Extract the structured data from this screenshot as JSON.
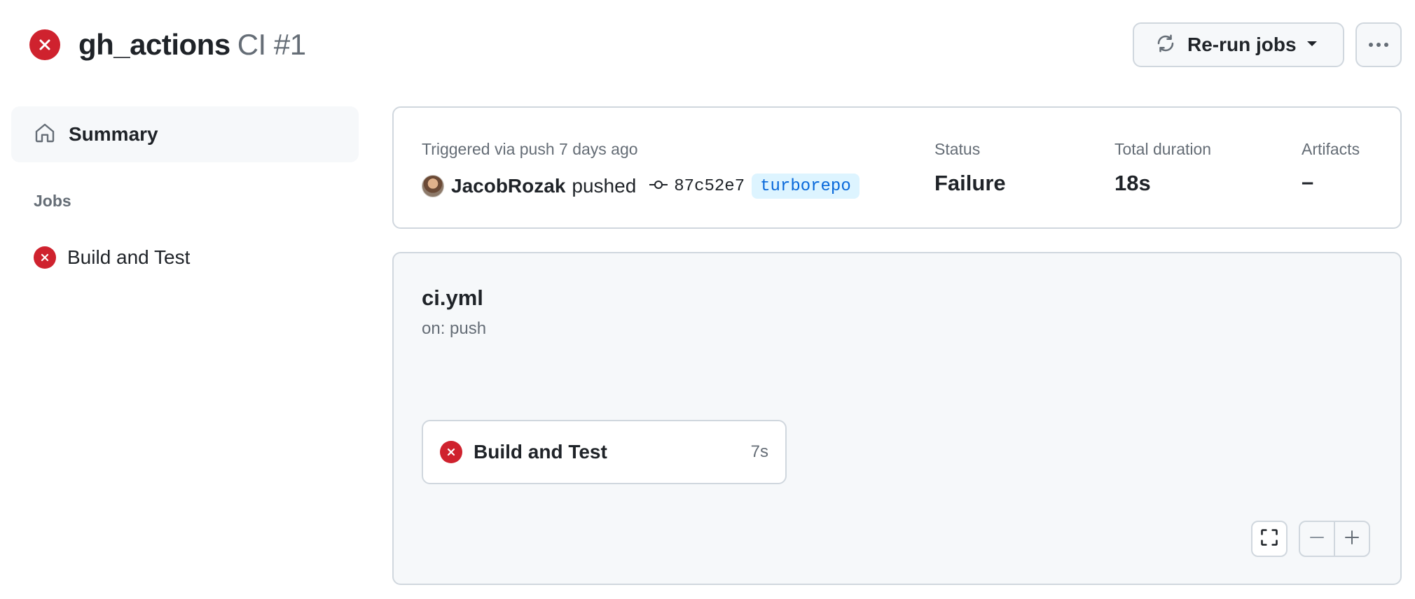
{
  "header": {
    "title": "gh_actions",
    "title_suffix": "CI #1",
    "status_icon": "x-circle-fill-icon",
    "rerun_label": "Re-run jobs",
    "more_icon": "kebab-horizontal-icon"
  },
  "sidebar": {
    "summary_label": "Summary",
    "jobs_heading": "Jobs",
    "jobs": [
      {
        "label": "Build and Test",
        "status": "failure"
      }
    ]
  },
  "summary": {
    "trigger_text": "Triggered via push 7 days ago",
    "actor": "JacobRozak",
    "action": "pushed",
    "commit_sha": "87c52e7",
    "branch": "turborepo",
    "status_label": "Status",
    "status_value": "Failure",
    "duration_label": "Total duration",
    "duration_value": "18s",
    "artifacts_label": "Artifacts",
    "artifacts_value": "–"
  },
  "workflow": {
    "file": "ci.yml",
    "trigger": "on: push",
    "jobs": [
      {
        "label": "Build and Test",
        "duration": "7s",
        "status": "failure"
      }
    ]
  },
  "colors": {
    "failure": "#cf222e",
    "accent": "#0969da",
    "badge_bg": "#ddf4ff",
    "muted": "#656d76",
    "border": "#d0d7de",
    "canvas_subtle": "#f6f8fa"
  }
}
